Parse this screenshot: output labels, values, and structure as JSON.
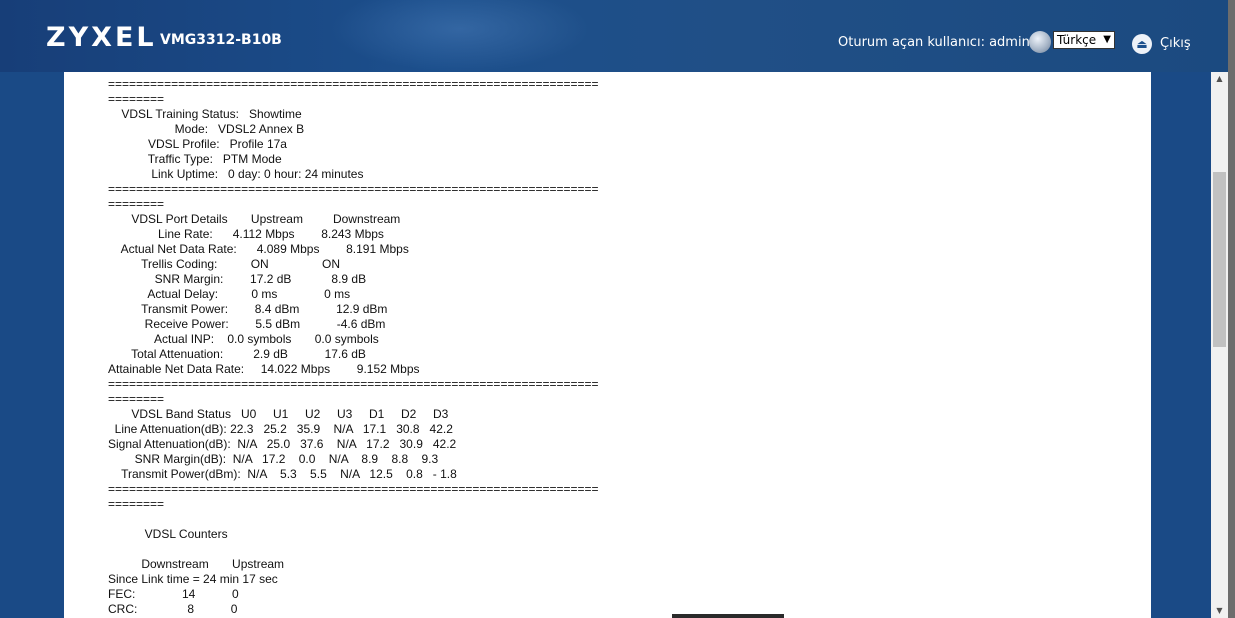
{
  "header": {
    "brand": "ZYXEL",
    "model": "VMG3312-B10B",
    "user_text": "Oturum açan kullanıcı: admin",
    "language": "Türkçe",
    "logout_label": "Çıkış"
  },
  "status_text": "======================================================================\n========\n    VDSL Training Status:   Showtime\n                    Mode:   VDSL2 Annex B\n            VDSL Profile:   Profile 17a\n            Traffic Type:   PTM Mode\n             Link Uptime:   0 day: 0 hour: 24 minutes\n======================================================================\n========\n       VDSL Port Details       Upstream         Downstream\n               Line Rate:      4.112 Mbps        8.243 Mbps\n    Actual Net Data Rate:      4.089 Mbps        8.191 Mbps\n          Trellis Coding:          ON                ON\n              SNR Margin:        17.2 dB            8.9 dB\n            Actual Delay:          0 ms              0 ms\n          Transmit Power:        8.4 dBm           12.9 dBm\n           Receive Power:        5.5 dBm           -4.6 dBm\n              Actual INP:    0.0 symbols       0.0 symbols\n       Total Attenuation:         2.9 dB           17.6 dB\nAttainable Net Data Rate:     14.022 Mbps        9.152 Mbps\n======================================================================\n========\n       VDSL Band Status   U0     U1     U2     U3     D1     D2     D3\n  Line Attenuation(dB): 22.3   25.2   35.9    N/A   17.1   30.8   42.2\nSignal Attenuation(dB):  N/A   25.0   37.6    N/A   17.2   30.9   42.2\n        SNR Margin(dB):  N/A   17.2    0.0    N/A    8.9    8.8    9.3\n    Transmit Power(dBm):  N/A    5.3    5.5    N/A   12.5    0.8   - 1.8\n======================================================================\n========\n\n           VDSL Counters\n\n          Downstream       Upstream\nSince Link time = 24 min 17 sec\nFEC:              14           0\nCRC:               8           0"
}
